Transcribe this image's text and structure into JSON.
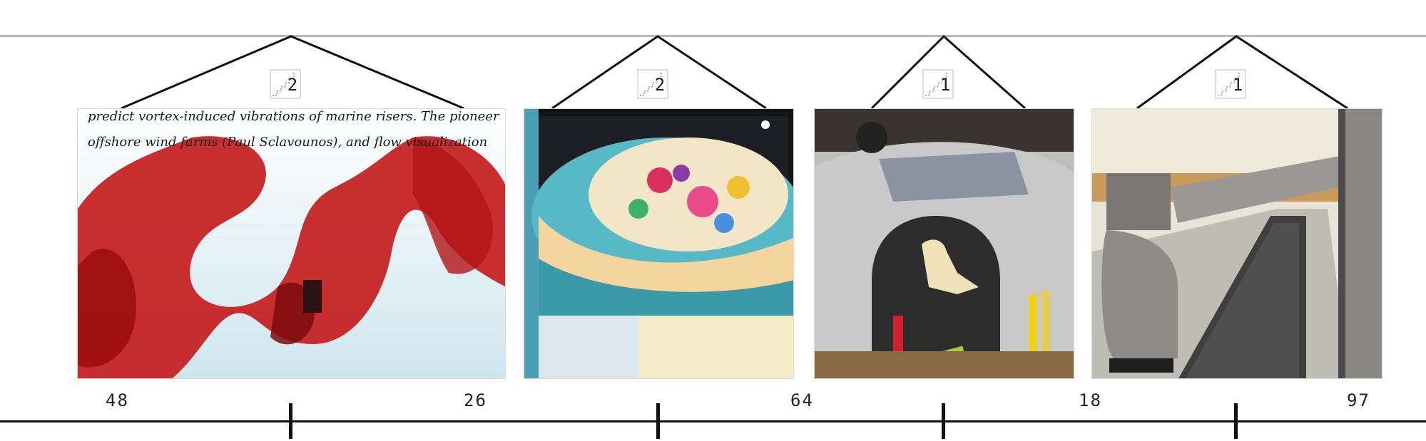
{
  "groups": [
    {
      "count": "2",
      "icon": "stairs-icon"
    },
    {
      "count": "2",
      "icon": "stairs-icon"
    },
    {
      "count": "1",
      "icon": "stairs-icon"
    },
    {
      "count": "1",
      "icon": "stairs-icon"
    }
  ],
  "thumbnails": [
    {
      "subject": "red dye flow visualization",
      "caption_line1": "predict vortex-induced vibrations of marine risers. The pioneer",
      "caption_line2": "offshore wind farms (Paul Sclavounos), and flow visualization"
    },
    {
      "subject": "colorful painted bowl artwork"
    },
    {
      "subject": "silver model car with figurine"
    },
    {
      "subject": "metal sculpture lettering in hallway"
    }
  ],
  "axis": {
    "labels": [
      "48",
      "26",
      "64",
      "18",
      "97"
    ]
  },
  "colors": {
    "top_rule": "#b7b3dc",
    "axis": "#111111"
  }
}
